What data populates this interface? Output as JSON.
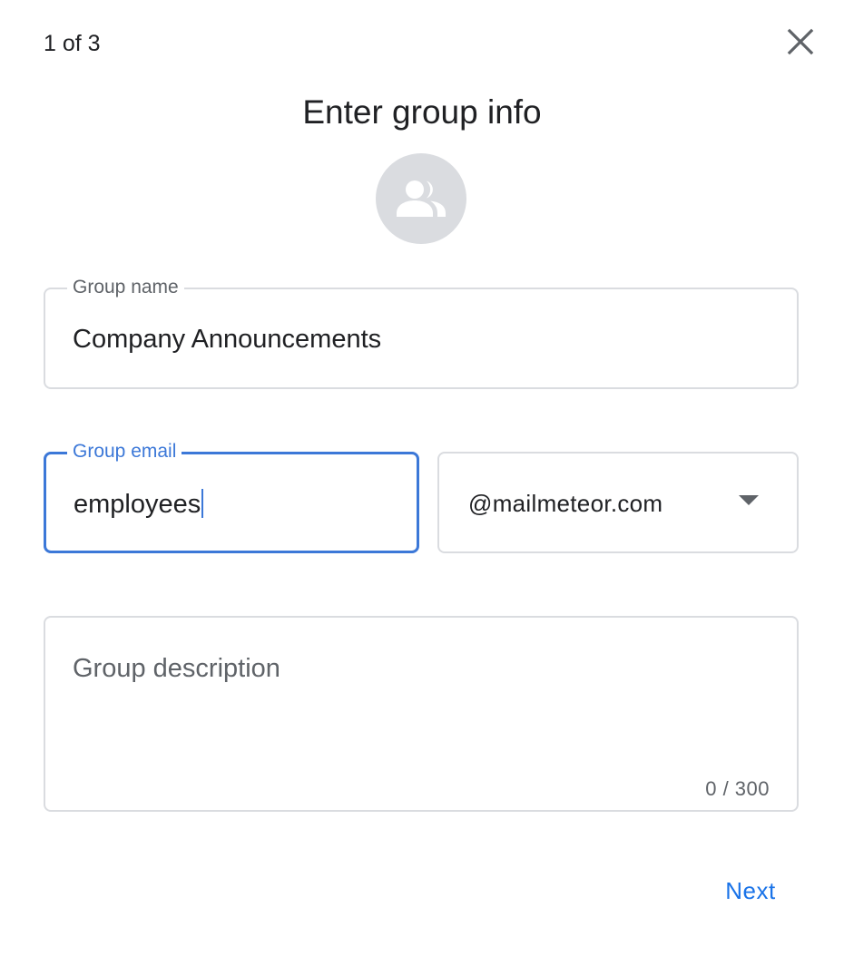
{
  "header": {
    "step_counter": "1 of 3",
    "close_icon": "close-icon",
    "title": "Enter group info",
    "avatar_icon": "group-icon"
  },
  "form": {
    "group_name": {
      "label": "Group name",
      "value": "Company Announcements"
    },
    "group_email": {
      "label": "Group email",
      "value": "employees"
    },
    "domain": {
      "selected": "@mailmeteor.com",
      "icon": "dropdown-arrow-icon"
    },
    "group_description": {
      "placeholder": "Group description",
      "value": "",
      "char_count": "0 / 300"
    }
  },
  "footer": {
    "next_label": "Next"
  },
  "colors": {
    "accent": "#3c78d8",
    "button_text": "#1a73e8",
    "border": "#dadce0",
    "avatar_bg": "#dadce0",
    "icon_fill": "#ffffff"
  }
}
